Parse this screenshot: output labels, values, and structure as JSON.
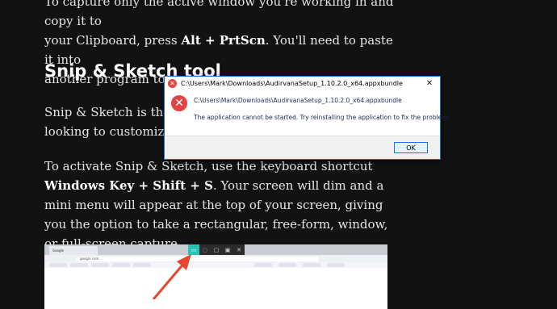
{
  "article": {
    "p1": {
      "line1": "To capture only the active window you're working in and copy it to",
      "line2a": "your Clipboard, press ",
      "key": "Alt + PrtScn",
      "line2b": ". You'll need to paste it into",
      "line3": "another program to save it."
    },
    "heading": "Snip & Sketch tool",
    "p2": {
      "line1": "Snip & Sketch is the best",
      "line2": "looking to customize, an"
    },
    "p3": {
      "a": "To activate Snip & Sketch, use the keyboard shortcut ",
      "key": "Windows Key + Shift + S",
      "b": ". Your screen will dim and a mini menu will appear at the top of your screen, giving you the option to take a rectangular, free-form, window, or full-screen capture."
    }
  },
  "screenshot": {
    "tab_label": "Google",
    "url": "google.com"
  },
  "dialog": {
    "title": "C:\\Users\\Mark\\Downloads\\AudirvanaSetup_1.10.2.0_x64.appxbundle",
    "close_glyph": "✕",
    "error_glyph": "✕",
    "path": "C:\\Users\\Mark\\Downloads\\AudirvanaSetup_1.10.2.0_x64.appxbundle",
    "message": "The application cannot be started. Try reinstalling the application to fix the problem.",
    "ok_label": "OK"
  },
  "colors": {
    "page_bg": "#121212",
    "dialog_border": "#1a6fd1",
    "error_red": "#e04343",
    "snip_accent": "#27c4b4",
    "arrow": "#e8452c"
  }
}
